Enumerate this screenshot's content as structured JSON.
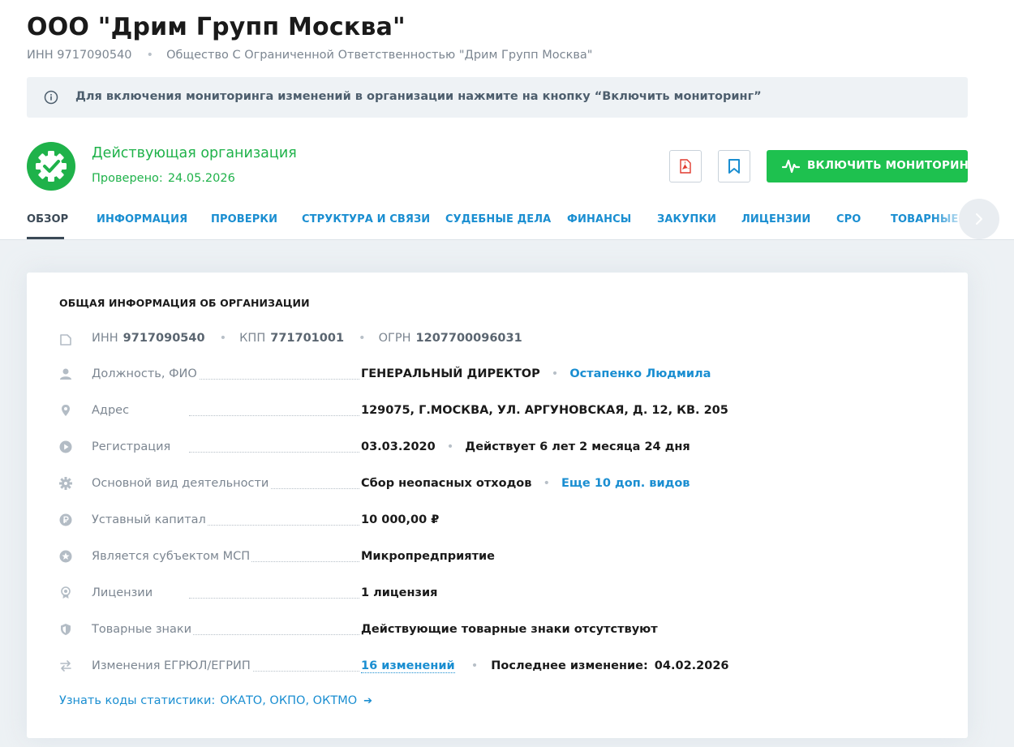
{
  "org": {
    "title": "ООО \"Дрим Групп Москва\"",
    "inn_line": "ИНН 9717090540",
    "full_name": "Общество С Ограниченной Ответственностью \"Дрим Групп Москва\""
  },
  "notice": {
    "text": "Для включения мониторинга изменений в организации нажмите на кнопку “Включить мониторинг”",
    "icon": "info-icon"
  },
  "status": {
    "title": "Действующая организация",
    "checked_label": "Проверено:",
    "checked_date": "24.05.2026",
    "icon": "gear-check-icon"
  },
  "actions": {
    "pdf_icon": "pdf-icon",
    "bookmark_icon": "bookmark-icon",
    "monitor_label": "ВКЛЮЧИТЬ МОНИТОРИНГ",
    "monitor_icon": "pulse-icon"
  },
  "tabs": [
    {
      "label": "ОБЗОР",
      "active": true
    },
    {
      "label": "ИНФОРМАЦИЯ"
    },
    {
      "label": "ПРОВЕРКИ"
    },
    {
      "label": "СТРУКТУРА И СВЯЗИ"
    },
    {
      "label": "СУДЕБНЫЕ ДЕЛА"
    },
    {
      "label": "ФИНАНСЫ"
    },
    {
      "label": "ЗАКУПКИ"
    },
    {
      "label": "ЛИЦЕНЗИИ"
    },
    {
      "label": "СРО"
    },
    {
      "label": "ТОВАРНЫЕ ЗН"
    }
  ],
  "card": {
    "title": "ОБЩАЯ ИНФОРМАЦИЯ ОБ ОРГАНИЗАЦИИ",
    "ids": {
      "inn_label": "ИНН",
      "inn": "9717090540",
      "kpp_label": "КПП",
      "kpp": "771701001",
      "ogrn_label": "ОГРН",
      "ogrn": "1207700096031"
    },
    "rows": {
      "director": {
        "label": "Должность, ФИО",
        "position": "ГЕНЕРАЛЬНЫЙ ДИРЕКТОР",
        "name": "Остапенко Людмила"
      },
      "address": {
        "label": "Адрес",
        "value": "129075, Г.МОСКВА, УЛ. АРГУНОВСКАЯ, Д. 12, КВ. 205"
      },
      "registration": {
        "label": "Регистрация",
        "date": "03.03.2020",
        "duration": "Действует 6 лет 2 месяца 24 дня"
      },
      "activity": {
        "label": "Основной вид деятельности",
        "value": "Сбор неопасных отходов",
        "more": "Еще 10 доп. видов"
      },
      "capital": {
        "label": "Уставный капитал",
        "value": "10 000,00  ₽"
      },
      "msp": {
        "label": "Является субъектом МСП",
        "value": "Микропредприятие"
      },
      "licenses": {
        "label": "Лицензии",
        "value": "1 лицензия"
      },
      "trademarks": {
        "label": "Товарные знаки",
        "value": "Действующие товарные знаки отсутствуют"
      },
      "changes": {
        "label": "Изменения ЕГРЮЛ/ЕГРИП",
        "count": "16 изменений",
        "last_label": "Последнее изменение:",
        "last_date": "04.02.2026"
      }
    },
    "stats": {
      "label": "Узнать коды статистики:",
      "codes": "ОКАТО, ОКПО, ОКТМО",
      "arrow": "➔"
    }
  },
  "colors": {
    "accent_blue": "#1a8ed1",
    "green": "#1fb24a",
    "button_green": "#1ec14f"
  }
}
